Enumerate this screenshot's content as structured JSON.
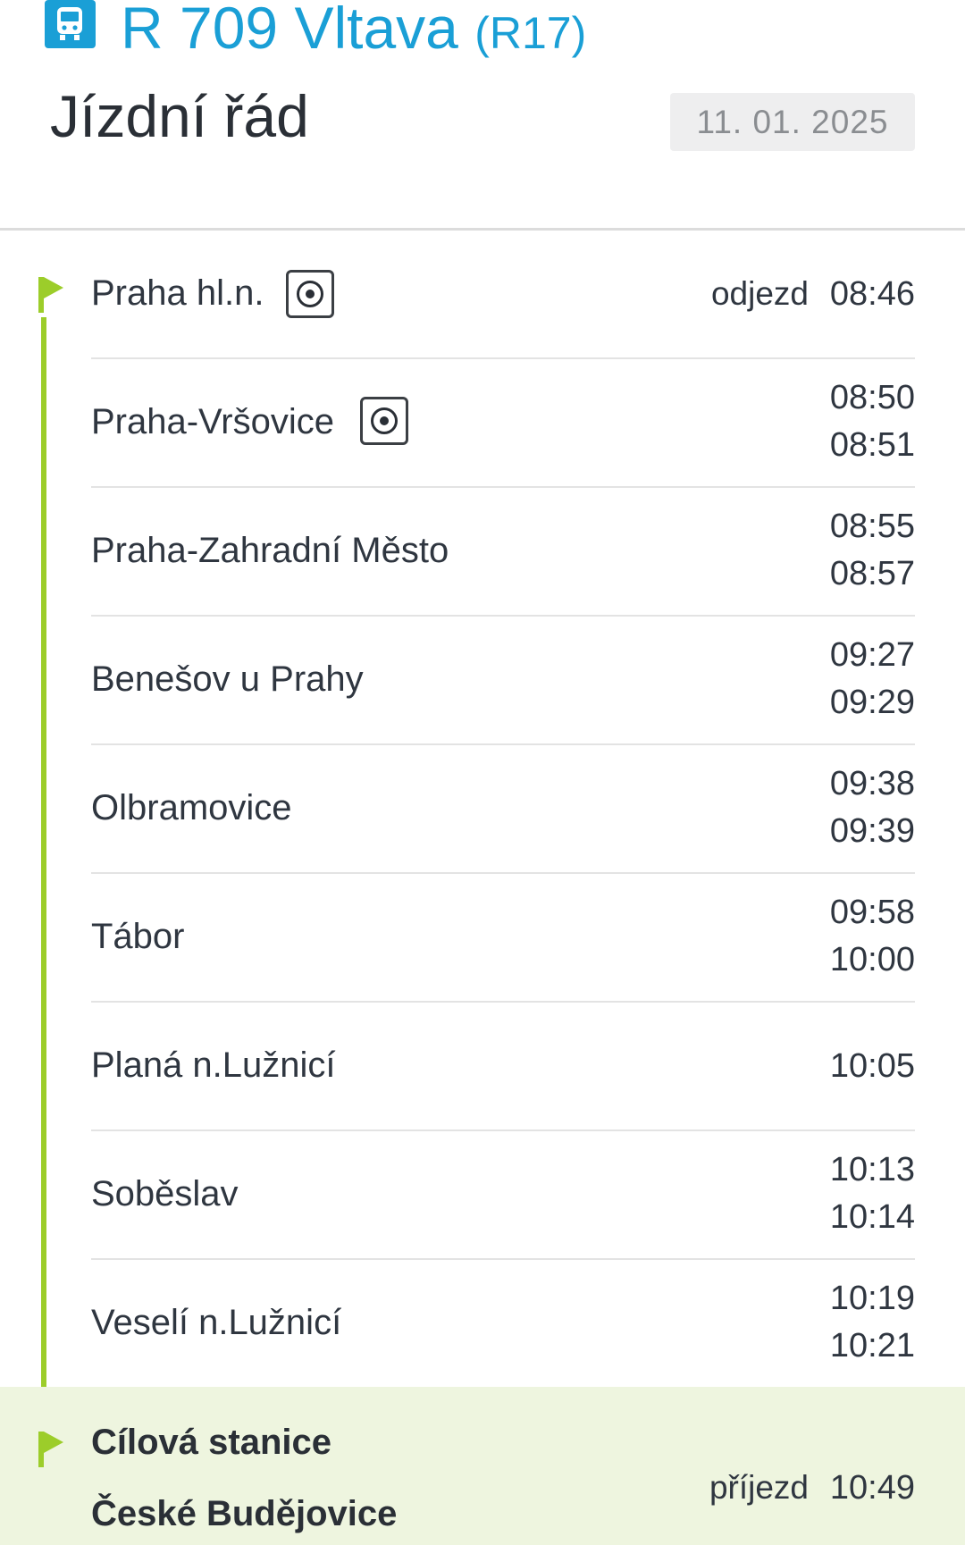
{
  "header": {
    "train_name": "R 709 Vltava",
    "train_code": "(R17)",
    "page_title": "Jízdní řád",
    "date": "11. 01. 2025",
    "icon": "train-icon",
    "accent_color": "#1a9fd6"
  },
  "route_color": "#9ccd2a",
  "stops": [
    {
      "name": "Praha hl.n.",
      "platform_icon": true,
      "label": "odjezd",
      "times": [
        "08:46"
      ]
    },
    {
      "name": "Praha-Vršovice",
      "platform_icon": true,
      "times": [
        "08:50",
        "08:51"
      ]
    },
    {
      "name": "Praha-Zahradní Město",
      "times": [
        "08:55",
        "08:57"
      ]
    },
    {
      "name": "Benešov u Prahy",
      "times": [
        "09:27",
        "09:29"
      ]
    },
    {
      "name": "Olbramovice",
      "times": [
        "09:38",
        "09:39"
      ]
    },
    {
      "name": "Tábor",
      "times": [
        "09:58",
        "10:00"
      ]
    },
    {
      "name": "Planá n.Lužnicí",
      "times": [
        "10:05"
      ]
    },
    {
      "name": "Soběslav",
      "times": [
        "10:13",
        "10:14"
      ]
    },
    {
      "name": "Veselí n.Lužnicí",
      "times": [
        "10:19",
        "10:21"
      ]
    }
  ],
  "destination": {
    "label_line": "Cílová stanice",
    "name": "České Budějovice",
    "label": "příjezd",
    "time": "10:49"
  }
}
